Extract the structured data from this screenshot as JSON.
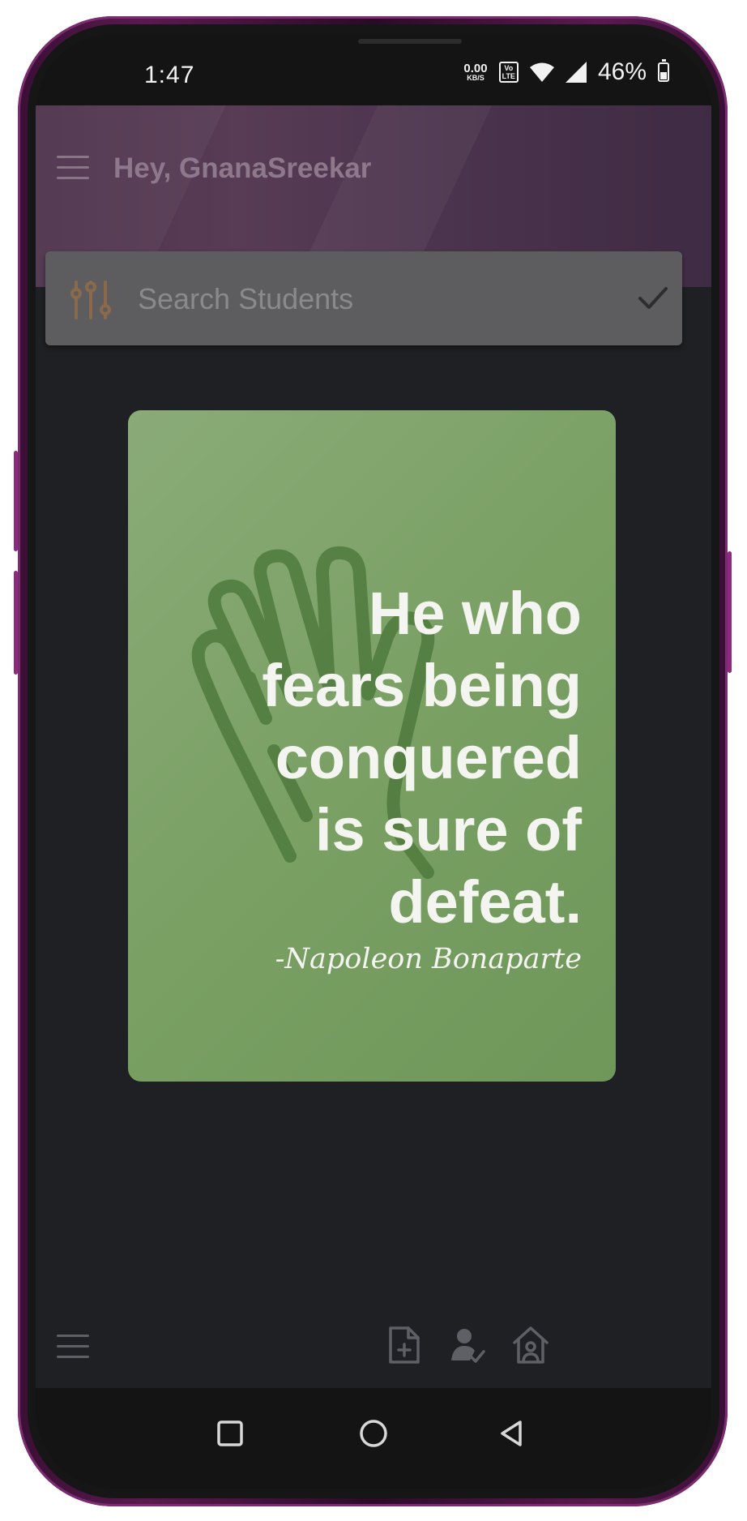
{
  "status_bar": {
    "time": "1:47",
    "net_speed_value": "0.00",
    "net_speed_unit": "KB/S",
    "volte_top": "Vo",
    "volte_bottom": "LTE",
    "battery_percent": "46%",
    "battery_level": 0.46,
    "icons": [
      "network-speed-icon",
      "volte-icon",
      "wifi-icon",
      "cell-signal-icon",
      "battery-icon"
    ]
  },
  "header": {
    "menu_icon": "hamburger-menu-icon",
    "greeting": "Hey, GnanaSreekar"
  },
  "search": {
    "filter_icon": "filter-sliders-icon",
    "placeholder": "Search Students",
    "value": "",
    "confirm_icon": "checkmark-icon"
  },
  "quote": {
    "lines": [
      "He who",
      "fears being",
      "conquered",
      "is sure of",
      "defeat."
    ],
    "author": "-Napoleon Bonaparte",
    "background_icon": "raised-hand-icon"
  },
  "bottom_bar": {
    "menu_icon": "hamburger-menu-icon",
    "actions": [
      "add-document-icon",
      "student-approve-icon",
      "home-icon"
    ]
  },
  "nav_bar": {
    "buttons": [
      "recents-square-icon",
      "home-circle-icon",
      "back-triangle-icon"
    ]
  },
  "colors": {
    "screen_bg": "#1f2023",
    "header_bg": "#6b4566",
    "search_bar_bg": "#5d5d60",
    "filter_icon": "#8a6a4a",
    "quote_card": "#7aa064",
    "quote_text": "#f4f4f0",
    "hand_outline": "#4f7a3d",
    "frame": "#5a1a4f"
  }
}
